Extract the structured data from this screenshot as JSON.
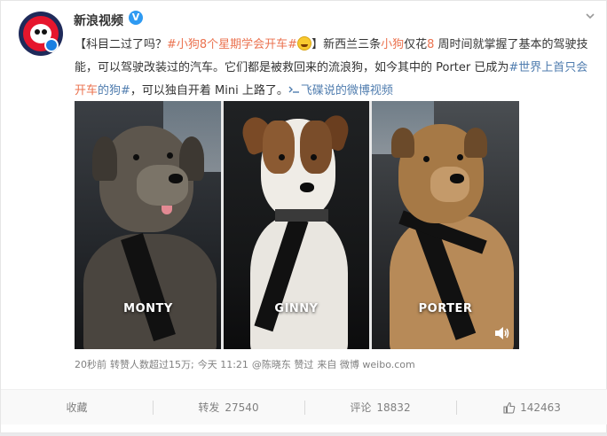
{
  "header": {
    "username": "新浪视频",
    "verified_mark": "V",
    "menu_icon": "chevron-down-icon"
  },
  "post": {
    "segment_1": "【科目二过了吗？",
    "topic_1": "#小狗8个星期学会开车#",
    "segment_2": "】新西兰三条",
    "highlight_1": "小狗",
    "segment_3": "仅花",
    "highlight_2": "8",
    "segment_4": " 周时间就掌握了基本的驾驶技能，可以驾驶改装过的汽车。它们都是被救回来的流浪狗，如今其中的 Porter 已成为",
    "topic_2_prefix": "#世界上首只会",
    "topic_2_highlight": "开车",
    "topic_2_suffix": "的狗#",
    "segment_5": "，可以独自开着 Mini 上路了。",
    "video_link": "飞碟说的微博视频",
    "colors": {
      "topic": "#eb7350",
      "link": "#507daf"
    }
  },
  "media": {
    "dogs": [
      {
        "name": "MONTY"
      },
      {
        "name": "GINNY"
      },
      {
        "name": "PORTER"
      }
    ],
    "volume_icon": "speaker-icon"
  },
  "meta": {
    "time_ago": "20秒前",
    "reposts_note": "转赞人数超过15万;",
    "today": "今天 11:21",
    "liked_by": "@陈晓东 赞过",
    "source": "来自 微博 weibo.com"
  },
  "actions": {
    "favorite": "收藏",
    "repost_label": "转发",
    "repost_count": "27540",
    "comment_label": "评论",
    "comment_count": "18832",
    "like_count": "142463"
  }
}
